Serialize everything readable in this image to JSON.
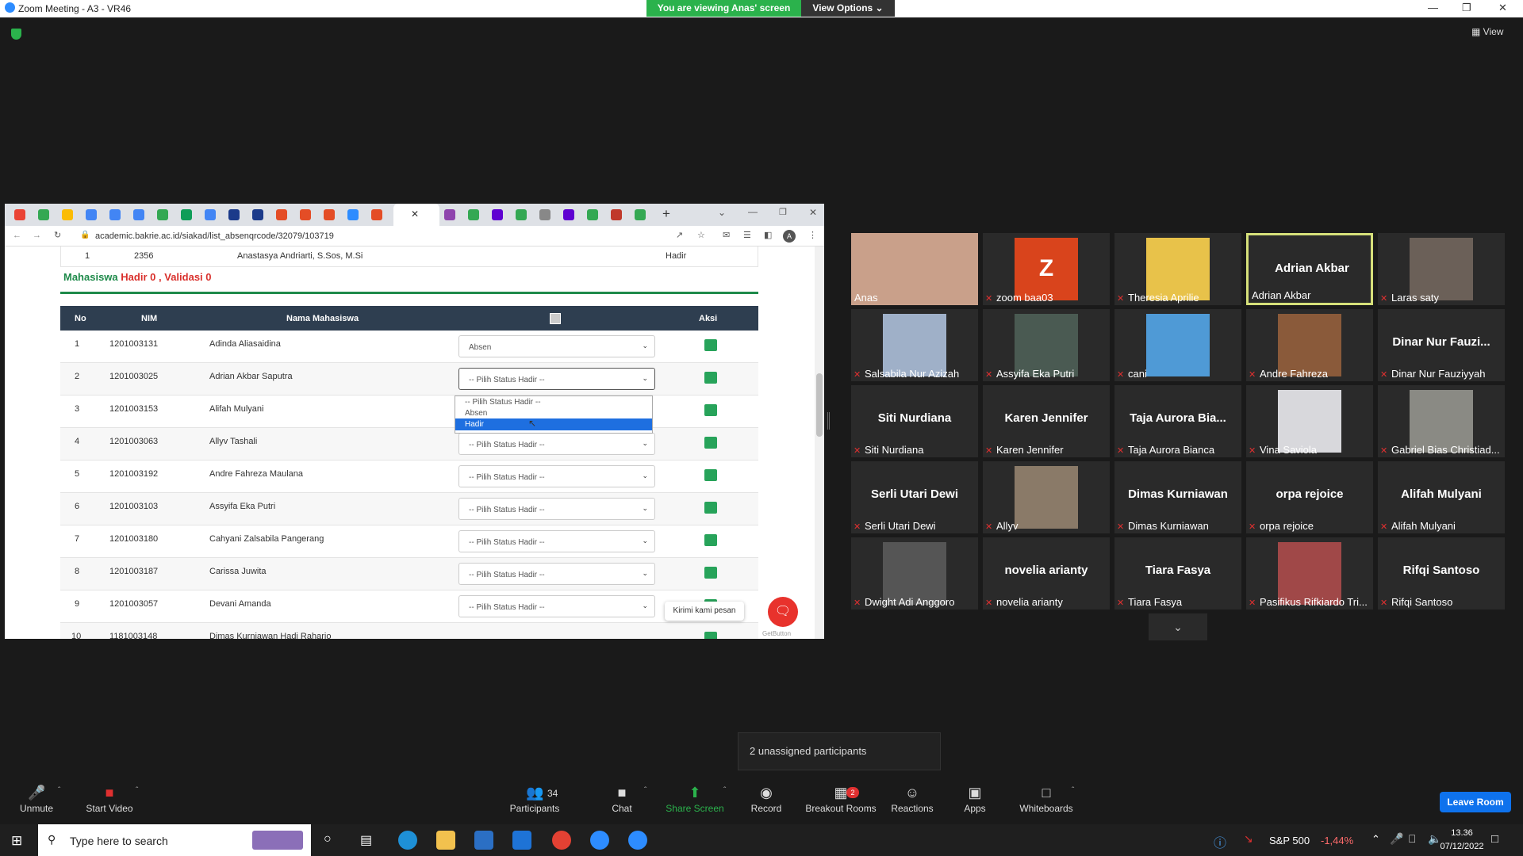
{
  "window": {
    "title": "Zoom Meeting - A3 - VR46",
    "viewing_banner": "You are viewing Anas' screen",
    "view_options": "View Options"
  },
  "view_button": "View",
  "browser": {
    "url": "academic.bakrie.ac.id/siakad/list_absenqrcode/32079/103719",
    "profile_initial": "A"
  },
  "lecturer_row": {
    "no": "1",
    "id": "2356",
    "name": "Anastasya Andriarti, S.Sos, M.Si",
    "status": "Hadir"
  },
  "summary": {
    "label": "Mahasiswa",
    "hadir_label": "Hadir",
    "hadir_count": "0",
    "sep": ",",
    "validasi_label": "Validasi",
    "validasi_count": "0"
  },
  "table": {
    "headers": {
      "no": "No",
      "nim": "NIM",
      "nama": "Nama Mahasiswa",
      "aksi": "Aksi"
    },
    "rows": [
      {
        "no": "1",
        "nim": "1201003131",
        "nama": "Adinda Aliasaidina",
        "status": "Absen"
      },
      {
        "no": "2",
        "nim": "1201003025",
        "nama": "Adrian Akbar Saputra",
        "status": "-- Pilih Status Hadir --"
      },
      {
        "no": "3",
        "nim": "1201003153",
        "nama": "Alifah Mulyani",
        "status": ""
      },
      {
        "no": "4",
        "nim": "1201003063",
        "nama": "Allyv Tashali",
        "status": "-- Pilih Status Hadir --"
      },
      {
        "no": "5",
        "nim": "1201003192",
        "nama": "Andre Fahreza Maulana",
        "status": "-- Pilih Status Hadir --"
      },
      {
        "no": "6",
        "nim": "1201003103",
        "nama": "Assyifa Eka Putri",
        "status": "-- Pilih Status Hadir --"
      },
      {
        "no": "7",
        "nim": "1201003180",
        "nama": "Cahyani Zalsabila Pangerang",
        "status": "-- Pilih Status Hadir --"
      },
      {
        "no": "8",
        "nim": "1201003187",
        "nama": "Carissa Juwita",
        "status": "-- Pilih Status Hadir --"
      },
      {
        "no": "9",
        "nim": "1201003057",
        "nama": "Devani Amanda",
        "status": "-- Pilih Status Hadir --"
      },
      {
        "no": "10",
        "nim": "1181003148",
        "nama": "Dimas Kurniawan Hadi Raharjo",
        "status": ""
      }
    ]
  },
  "dropdown_options": [
    "-- Pilih Status Hadir --",
    "Absen",
    "Hadir"
  ],
  "chat_widget": {
    "label": "Kirimi kami pesan",
    "credit": "GetButton"
  },
  "participants": [
    {
      "big": "",
      "name": "Anas",
      "muted": false,
      "color": "#c9a08a"
    },
    {
      "big": "Z",
      "name": "zoom baa03",
      "muted": true,
      "color": "#d9441c"
    },
    {
      "big": "",
      "name": "Theresia Aprilie",
      "muted": true,
      "color": "#e8c24a"
    },
    {
      "big": "Adrian Akbar",
      "name": "Adrian Akbar",
      "muted": false,
      "color": ""
    },
    {
      "big": "",
      "name": "Laras saty",
      "muted": true,
      "color": "#6b6058"
    },
    {
      "big": "",
      "name": "Salsabila Nur Azizah",
      "muted": true,
      "color": "#9fb0c8"
    },
    {
      "big": "",
      "name": "Assyifa Eka Putri",
      "muted": true,
      "color": "#4a5a52"
    },
    {
      "big": "",
      "name": "cani",
      "muted": true,
      "color": "#4f9ad6"
    },
    {
      "big": "",
      "name": "Andre Fahreza",
      "muted": true,
      "color": "#8a5a3a"
    },
    {
      "big": "Dinar Nur Fauzi...",
      "name": "Dinar Nur Fauziyyah",
      "muted": true,
      "color": ""
    },
    {
      "big": "Siti Nurdiana",
      "name": "Siti Nurdiana",
      "muted": true,
      "color": ""
    },
    {
      "big": "Karen Jennifer",
      "name": "Karen Jennifer",
      "muted": true,
      "color": ""
    },
    {
      "big": "Taja Aurora Bia...",
      "name": "Taja Aurora Bianca",
      "muted": true,
      "color": ""
    },
    {
      "big": "",
      "name": "Vina Saviola",
      "muted": true,
      "color": "#d8d8dc"
    },
    {
      "big": "",
      "name": "Gabriel Bias Christiad...",
      "muted": true,
      "color": "#8a8a84"
    },
    {
      "big": "Serli Utari Dewi",
      "name": "Serli Utari Dewi",
      "muted": true,
      "color": ""
    },
    {
      "big": "",
      "name": "Allyv",
      "muted": true,
      "color": "#8a7a68"
    },
    {
      "big": "Dimas Kurniawan",
      "name": "Dimas Kurniawan",
      "muted": true,
      "color": ""
    },
    {
      "big": "orpa rejoice",
      "name": "orpa rejoice",
      "muted": true,
      "color": ""
    },
    {
      "big": "Alifah Mulyani",
      "name": "Alifah Mulyani",
      "muted": true,
      "color": ""
    },
    {
      "big": "",
      "name": "Dwight Adi Anggoro",
      "muted": true,
      "color": "#555"
    },
    {
      "big": "novelia arianty",
      "name": "novelia arianty",
      "muted": true,
      "color": ""
    },
    {
      "big": "Tiara Fasya",
      "name": "Tiara Fasya",
      "muted": true,
      "color": ""
    },
    {
      "big": "",
      "name": "Pasifikus Rifkiardo Tri...",
      "muted": true,
      "color": "#a04848"
    },
    {
      "big": "Rifqi Santoso",
      "name": "Rifqi Santoso",
      "muted": true,
      "color": ""
    }
  ],
  "unassigned": "2 unassigned participants",
  "toolbar": {
    "unmute": "Unmute",
    "start_video": "Start Video",
    "participants": "Participants",
    "participants_count": "34",
    "chat": "Chat",
    "share": "Share Screen",
    "record": "Record",
    "breakout": "Breakout Rooms",
    "breakout_badge": "2",
    "reactions": "Reactions",
    "apps": "Apps",
    "whiteboards": "Whiteboards",
    "leave": "Leave Room"
  },
  "taskbar": {
    "search_placeholder": "Type here to search",
    "stock_name": "S&P 500",
    "stock_change": "-1,44%",
    "time": "13.36",
    "date": "07/12/2022"
  }
}
